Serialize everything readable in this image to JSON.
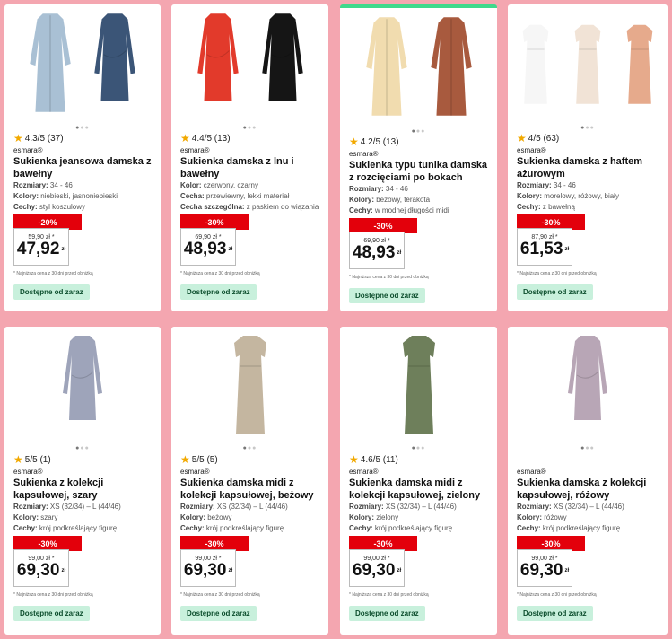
{
  "brand": "esmara®",
  "available_label": "Dostępne od zaraz",
  "lowest_price_note": "* Najniższa cena z 30 dni przed obniżką",
  "currency_suffix": "zł",
  "colors": {
    "page_bg": "#f4a6b0",
    "discount": "#e3000b",
    "available_bg": "#c8f0dc",
    "active_bar": "#3fd98c",
    "star": "#f2a900"
  },
  "products": [
    {
      "rating": "4.3/5 (37)",
      "title": "Sukienka jeansowa damska z bawełny",
      "attrs": [
        {
          "k": "Rozmiary:",
          "v": " 34 - 46"
        },
        {
          "k": "Kolory:",
          "v": " niebieski, jasnoniebieski"
        },
        {
          "k": "Cechy:",
          "v": " styl koszulowy"
        }
      ],
      "discount": "-20%",
      "old_price": "59,90 zł *",
      "price": "47,92",
      "img": [
        "#a9c0d4",
        "#3b5577"
      ]
    },
    {
      "rating": "4.4/5 (13)",
      "title": "Sukienka damska z lnu i bawełny",
      "attrs": [
        {
          "k": "Kolor:",
          "v": " czerwony, czarny"
        },
        {
          "k": "Cecha:",
          "v": " przewiewny, lekki materiał"
        },
        {
          "k": "Cecha szczególna:",
          "v": " z paskiem do wiązania"
        }
      ],
      "discount": "-30%",
      "old_price": "69,90 zł *",
      "price": "48,93",
      "img": [
        "#e23a2b",
        "#151515"
      ]
    },
    {
      "rating": "4.2/5 (13)",
      "title": "Sukienka typu tunika damska z rozcięciami po bokach",
      "attrs": [
        {
          "k": "Rozmiary:",
          "v": " 34 - 46"
        },
        {
          "k": "Kolory:",
          "v": " beżowy, terakota"
        },
        {
          "k": "Cechy:",
          "v": " w modnej długości midi"
        }
      ],
      "discount": "-30%",
      "old_price": "69,90 zł *",
      "price": "48,93",
      "img": [
        "#f1dcaf",
        "#a85a3e"
      ]
    },
    {
      "rating": "4/5 (63)",
      "title": "Sukienka damska z haftem ażurowym",
      "attrs": [
        {
          "k": "Rozmiary:",
          "v": " 34 - 46"
        },
        {
          "k": "Kolory:",
          "v": " morelowy, różowy, biały"
        },
        {
          "k": "Cechy:",
          "v": " z bawełną"
        }
      ],
      "discount": "-30%",
      "old_price": "87,90 zł *",
      "price": "61,53",
      "img": [
        "#f6f6f6",
        "#f1e3d6",
        "#e6aa8c"
      ]
    },
    {
      "rating": "5/5 (1)",
      "title": "Sukienka z kolekcji kapsułowej, szary",
      "attrs": [
        {
          "k": "Rozmiary:",
          "v": " XS (32/34) – L (44/46)"
        },
        {
          "k": "Kolory:",
          "v": " szary"
        },
        {
          "k": "Cechy:",
          "v": " krój podkreślający figurę"
        }
      ],
      "discount": "-30%",
      "old_price": "99,00 zł *",
      "price": "69,30",
      "img": [
        "#9ea4ba"
      ]
    },
    {
      "rating": "5/5 (5)",
      "title": "Sukienka damska midi z kolekcji kapsułowej, beżowy",
      "attrs": [
        {
          "k": "Rozmiary:",
          "v": " XS (32/34) – L (44/46)"
        },
        {
          "k": "Kolory:",
          "v": " beżowy"
        },
        {
          "k": "Cechy:",
          "v": " krój podkreślający figurę"
        }
      ],
      "discount": "-30%",
      "old_price": "99,00 zł *",
      "price": "69,30",
      "img": [
        "#c4b6a0"
      ]
    },
    {
      "rating": "4.6/5 (11)",
      "title": "Sukienka damska midi z kolekcji kapsułowej, zielony",
      "attrs": [
        {
          "k": "Rozmiary:",
          "v": " XS (32/34) – L (44/46)"
        },
        {
          "k": "Kolory:",
          "v": " zielony"
        },
        {
          "k": "Cechy:",
          "v": " krój podkreślający figurę"
        }
      ],
      "discount": "-30%",
      "old_price": "99,00 zł *",
      "price": "69,30",
      "img": [
        "#6e7f5b"
      ]
    },
    {
      "rating": "",
      "title": "Sukienka damska z kolekcji kapsułowej, różowy",
      "attrs": [
        {
          "k": "Rozmiary:",
          "v": " XS (32/34) – L (44/46)"
        },
        {
          "k": "Kolory:",
          "v": " różowy"
        },
        {
          "k": "Cechy:",
          "v": " krój podkreślający figurę"
        }
      ],
      "discount": "-30%",
      "old_price": "99,00 zł *",
      "price": "69,30",
      "img": [
        "#b8a6b6"
      ]
    }
  ]
}
